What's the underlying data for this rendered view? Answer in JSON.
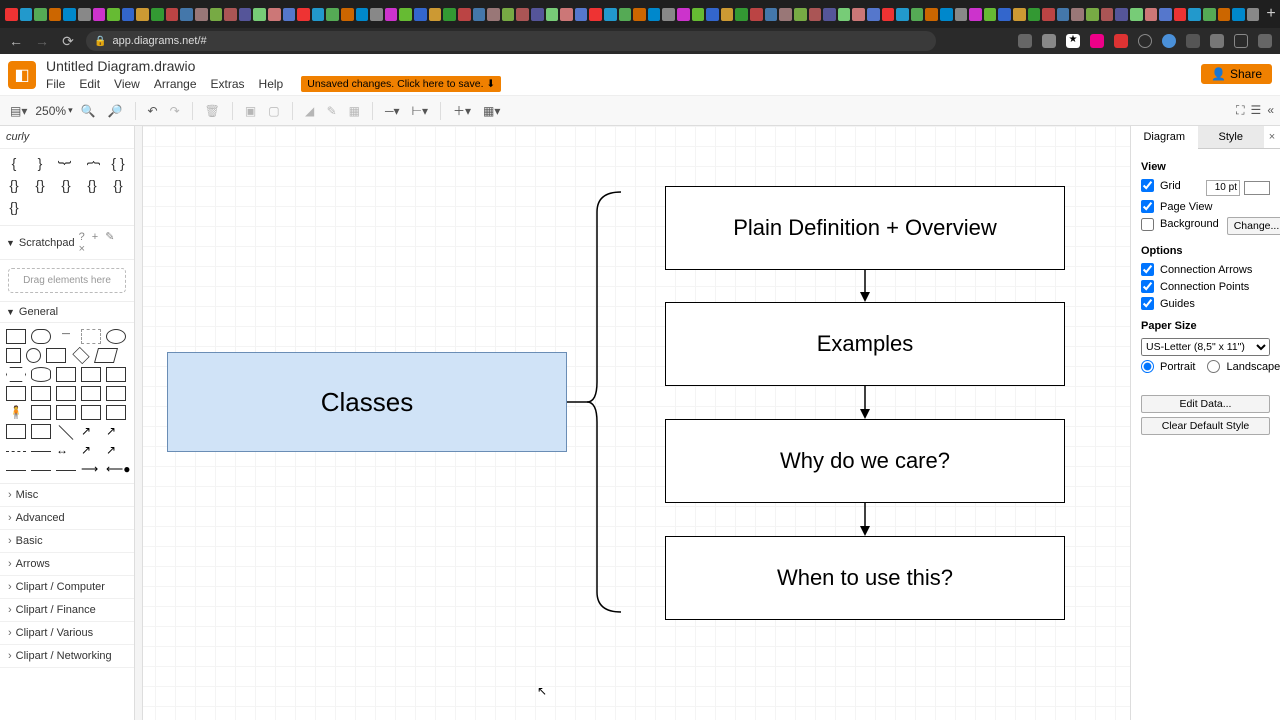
{
  "browser": {
    "url": "app.diagrams.net/#"
  },
  "header": {
    "title": "Untitled Diagram.drawio",
    "menu": [
      "File",
      "Edit",
      "View",
      "Arrange",
      "Extras",
      "Help"
    ],
    "banner": "Unsaved changes. Click here to save. ⬇",
    "share": "Share"
  },
  "toolbar": {
    "zoom": "250%"
  },
  "left": {
    "search": "curly",
    "scratchpad": "Scratchpad",
    "scratch_hint": "Drag elements here",
    "general": "General",
    "categories": [
      "Misc",
      "Advanced",
      "Basic",
      "Arrows",
      "Clipart / Computer",
      "Clipart / Finance",
      "Clipart / Various",
      "Clipart / Networking"
    ]
  },
  "diagram": {
    "classes": "Classes",
    "n1": "Plain Definition + Overview",
    "n2": "Examples",
    "n3": "Why do we care?",
    "n4": "When to use this?"
  },
  "right": {
    "tab_diagram": "Diagram",
    "tab_style": "Style",
    "view": "View",
    "grid": "Grid",
    "grid_val": "10 pt",
    "pageview": "Page View",
    "background": "Background",
    "change": "Change...",
    "options": "Options",
    "conn_arrows": "Connection Arrows",
    "conn_points": "Connection Points",
    "guides": "Guides",
    "papersize": "Paper Size",
    "paper_sel": "US-Letter (8,5\" x 11\")",
    "portrait": "Portrait",
    "landscape": "Landscape",
    "edit_data": "Edit Data...",
    "clear_style": "Clear Default Style"
  }
}
